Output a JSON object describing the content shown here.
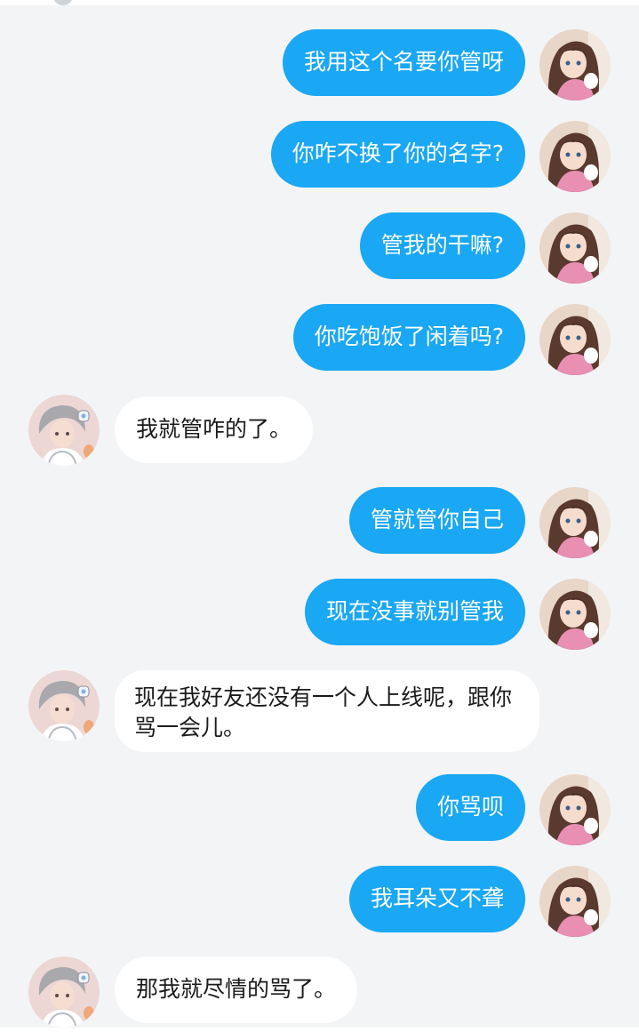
{
  "colors": {
    "background": "#f3f4f6",
    "sent_bubble": "#1aa7f3",
    "received_bubble": "#ffffff",
    "sent_text": "#ffffff",
    "received_text": "#1b1b1b"
  },
  "messages": [
    {
      "side": "right",
      "text": "我用这个名要你管呀"
    },
    {
      "side": "right",
      "text": "你咋不换了你的名字?"
    },
    {
      "side": "right",
      "text": "管我的干嘛?"
    },
    {
      "side": "right",
      "text": "你吃饱饭了闲着吗?"
    },
    {
      "side": "left",
      "text": "我就管咋的了。"
    },
    {
      "side": "right",
      "text": "管就管你自己"
    },
    {
      "side": "right",
      "text": "现在没事就别管我"
    },
    {
      "side": "left",
      "text": "现在我好友还没有一个人上线呢，跟你骂一会儿。"
    },
    {
      "side": "right",
      "text": "你骂呗"
    },
    {
      "side": "right",
      "text": "我耳朵又不聋"
    },
    {
      "side": "left",
      "text": "那我就尽情的骂了。"
    }
  ],
  "icons": {
    "self_avatar": "girl-avatar-icon",
    "other_avatar": "boy-avatar-icon"
  }
}
